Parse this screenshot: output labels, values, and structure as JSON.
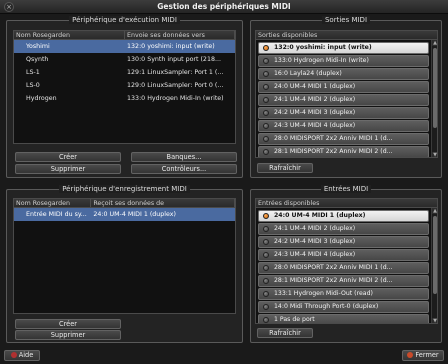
{
  "window": {
    "title": "Gestion des périphériques MIDI"
  },
  "playback": {
    "group_label": "Périphérique d'exécution MIDI",
    "columns": [
      "Nom Rosegarden",
      "Envoie ses données vers"
    ],
    "rows": [
      {
        "name": "Yoshimi",
        "target": "132:0 yoshimi: input (write)",
        "selected": true
      },
      {
        "name": "Qsynth",
        "target": "130:0 Synth input port (218...",
        "selected": false
      },
      {
        "name": "LS-1",
        "target": "129:1 LinuxSampler: Port 1 (...",
        "selected": false
      },
      {
        "name": "LS-0",
        "target": "129:0 LinuxSampler: Port 0 (...",
        "selected": false
      },
      {
        "name": "Hydrogen",
        "target": "133:0 Hydrogen Midi-In (write)",
        "selected": false
      }
    ],
    "buttons": {
      "create": "Créer",
      "banks": "Banques...",
      "delete": "Supprimer",
      "controllers": "Contrôleurs..."
    }
  },
  "outputs": {
    "group_label": "Sorties MIDI",
    "list_header": "Sorties disponibles",
    "items": [
      {
        "label": "132:0 yoshimi: input (write)",
        "active": true
      },
      {
        "label": "133:0 Hydrogen Midi-In (write)",
        "active": false
      },
      {
        "label": "16:0 Layla24 (duplex)",
        "active": false
      },
      {
        "label": "24:0 UM-4 MIDI 1 (duplex)",
        "active": false
      },
      {
        "label": "24:1 UM-4 MIDI 2 (duplex)",
        "active": false
      },
      {
        "label": "24:2 UM-4 MIDI 3 (duplex)",
        "active": false
      },
      {
        "label": "24:3 UM-4 MIDI 4 (duplex)",
        "active": false
      },
      {
        "label": "28:0 MIDISPORT 2x2 Anniv MIDI 1 (d...",
        "active": false
      },
      {
        "label": "28:1 MIDISPORT 2x2 Anniv MIDI 2 (d...",
        "active": false
      }
    ],
    "refresh": "Rafraîchir"
  },
  "recording": {
    "group_label": "Périphérique d'enregistrement MIDI",
    "columns": [
      "Nom Rosegarden",
      "Reçoit ses données de"
    ],
    "rows": [
      {
        "name": "Entrée MIDI du sy...",
        "source": "24:0 UM-4 MIDI 1 (duplex)",
        "selected": true
      }
    ],
    "buttons": {
      "create": "Créer",
      "delete": "Supprimer"
    }
  },
  "inputs": {
    "group_label": "Entrées MIDI",
    "list_header": "Entrées disponibles",
    "items": [
      {
        "label": "24:0 UM-4 MIDI 1 (duplex)",
        "active": true
      },
      {
        "label": "24:1 UM-4 MIDI 2 (duplex)",
        "active": false
      },
      {
        "label": "24:2 UM-4 MIDI 3 (duplex)",
        "active": false
      },
      {
        "label": "24:3 UM-4 MIDI 4 (duplex)",
        "active": false
      },
      {
        "label": "28:0 MIDISPORT 2x2 Anniv MIDI 1 (d...",
        "active": false
      },
      {
        "label": "28:1 MIDISPORT 2x2 Anniv MIDI 2 (d...",
        "active": false
      },
      {
        "label": "133:1 Hydrogen Midi-Out (read)",
        "active": false
      },
      {
        "label": "14:0 Midi Through Port-0 (duplex)",
        "active": false
      },
      {
        "label": "1 Pas de port",
        "active": false
      }
    ],
    "refresh": "Rafraîchir"
  },
  "footer": {
    "help": "Aide",
    "close": "Fermer"
  },
  "colors": {
    "selection": "#4a6aa0",
    "active_led": "#e07a1e"
  }
}
